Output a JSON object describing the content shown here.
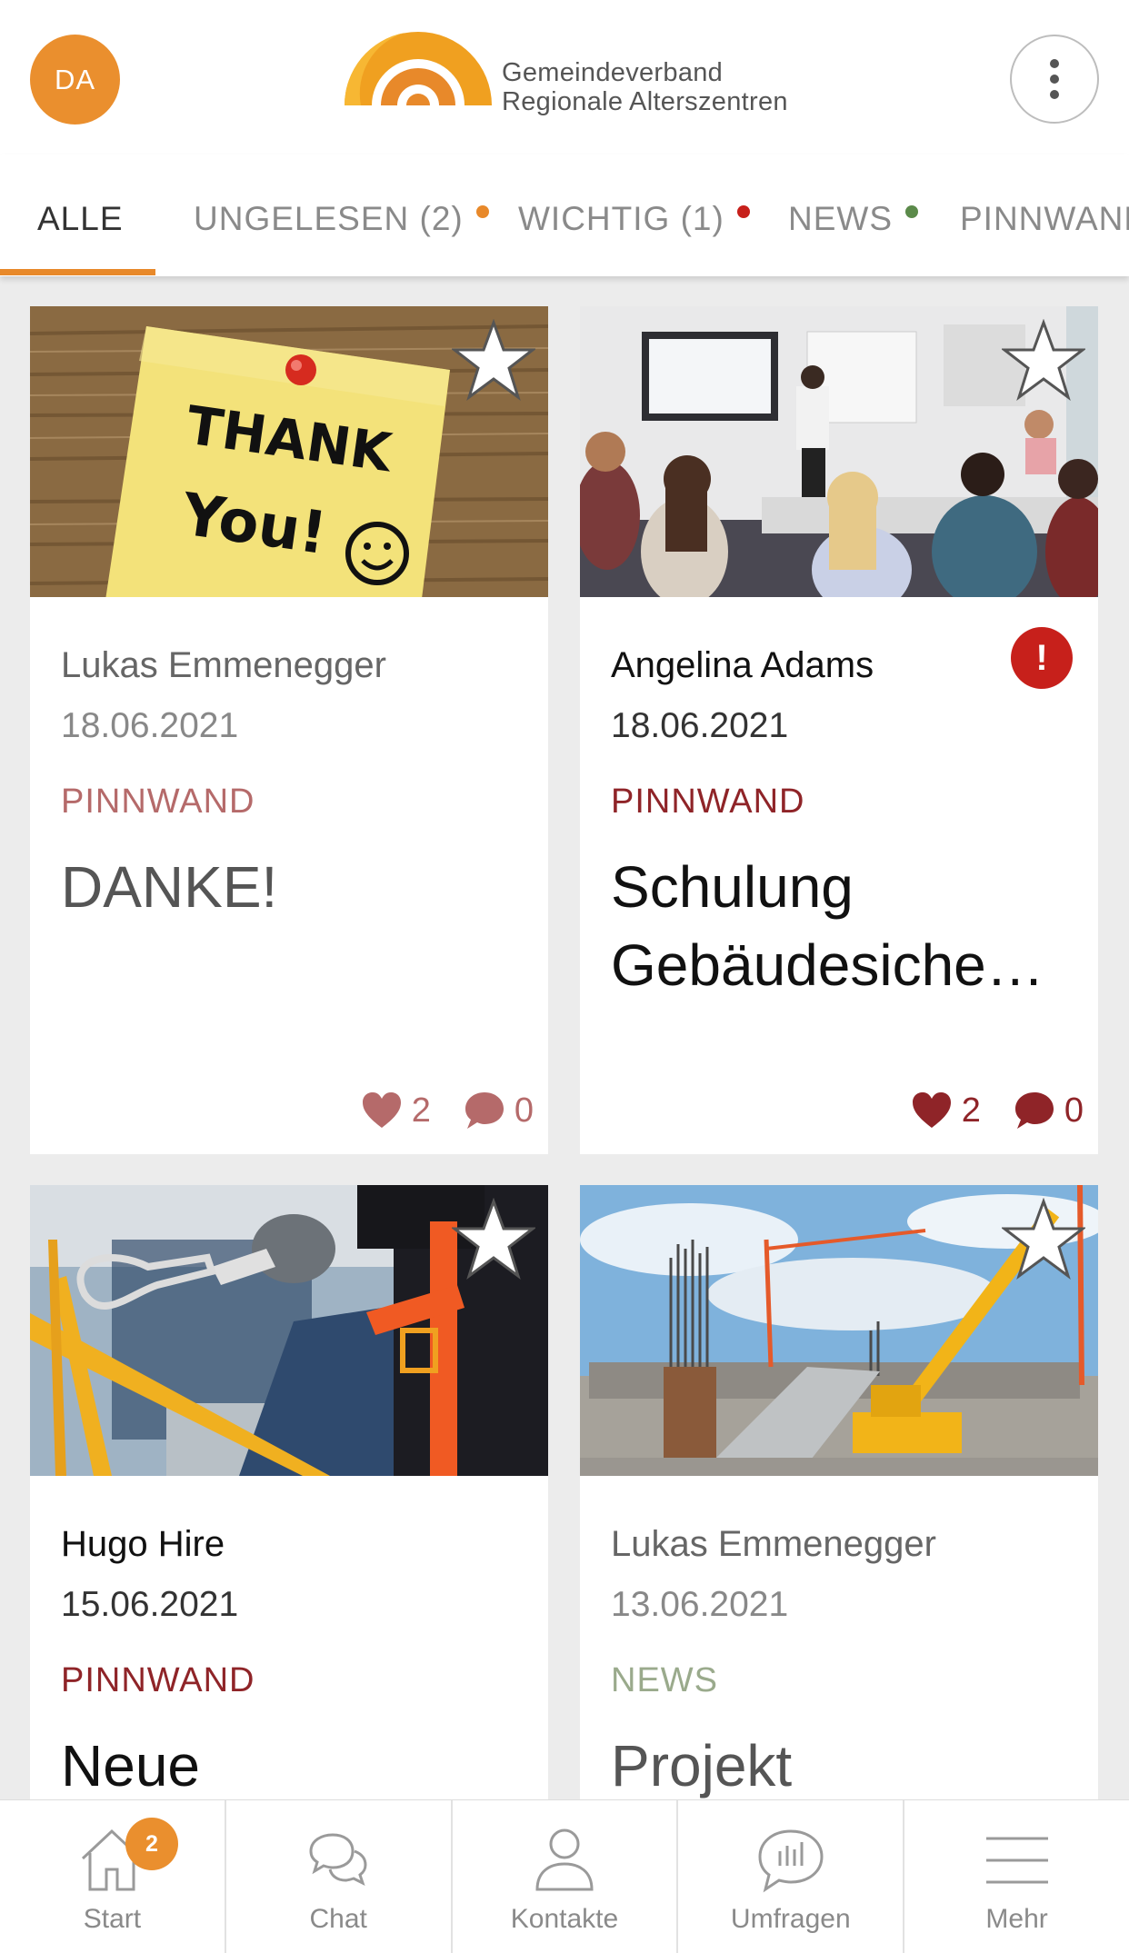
{
  "header": {
    "avatar_initials": "DA",
    "logo_line1": "Gemeindeverband",
    "logo_line2": "Regionale Alterszentren"
  },
  "tabs": [
    {
      "label": "ALLE",
      "active": true,
      "dot_color": null
    },
    {
      "label": "UNGELESEN (2)",
      "active": false,
      "dot_color": "#e8892a"
    },
    {
      "label": "WICHTIG (1)",
      "active": false,
      "dot_color": "#c7201b"
    },
    {
      "label": "NEWS",
      "active": false,
      "dot_color": "#5b8a4a"
    },
    {
      "label": "PINNWAND",
      "active": false,
      "dot_color": null
    }
  ],
  "cards": [
    {
      "author": "Lukas Emmenegger",
      "date": "18.06.2021",
      "category": "PINNWAND",
      "category_color": "#b56a6a",
      "title": "DANKE!",
      "likes": "2",
      "comments": "0",
      "read": true,
      "important": false,
      "image": "thank-you-note"
    },
    {
      "author": "Angelina Adams",
      "date": "18.06.2021",
      "category": "PINNWAND",
      "category_color": "#8f2428",
      "title": "Schulung Gebäudesiche…",
      "likes": "2",
      "comments": "0",
      "read": false,
      "important": true,
      "image": "training-presentation"
    },
    {
      "author": "Hugo Hire",
      "date": "15.06.2021",
      "category": "PINNWAND",
      "category_color": "#8f2428",
      "title": "Neue",
      "read": false,
      "important": false,
      "image": "safety-harness"
    },
    {
      "author": "Lukas Emmenegger",
      "date": "13.06.2021",
      "category": "NEWS",
      "category_color": "#9aaa8c",
      "title": "Projekt",
      "read": true,
      "important": false,
      "image": "construction-site"
    }
  ],
  "important_mark": "!",
  "bottom_nav": [
    {
      "label": "Start",
      "icon": "home-icon",
      "badge": "2"
    },
    {
      "label": "Chat",
      "icon": "chat-icon"
    },
    {
      "label": "Kontakte",
      "icon": "contacts-icon"
    },
    {
      "label": "Umfragen",
      "icon": "polls-icon"
    },
    {
      "label": "Mehr",
      "icon": "menu-icon"
    }
  ],
  "colors": {
    "accent": "#e8892a",
    "reaction_read": "#b56a6a",
    "reaction_unread": "#8f2428"
  }
}
